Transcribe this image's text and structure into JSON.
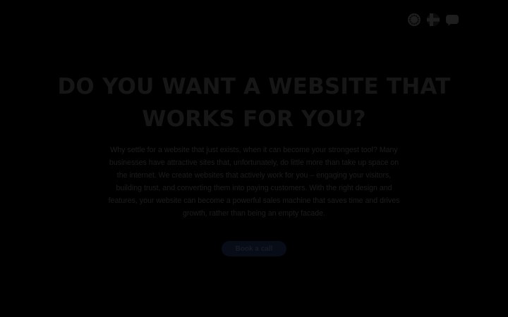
{
  "language_switcher": {
    "options": [
      {
        "icon": "eu-flag-icon"
      },
      {
        "icon": "finland-flag-icon"
      },
      {
        "icon": "chat-icon"
      }
    ]
  },
  "hero": {
    "title": "DO YOU WANT A WEBSITE THAT WORKS FOR YOU?",
    "description": "Why settle for a website that just exists, when it can become your strongest tool? Many businesses have attractive sites that, unfortunately, do little more than take up space on the internet. We create websites that actively work for you – engaging your visitors, building trust, and converting them into paying customers. With the right design and features, your website can become a powerful sales machine that saves time and drives growth, rather than being an empty facade.",
    "cta_label": "Book a call"
  },
  "colors": {
    "background": "#000000",
    "title": "#161616",
    "text": "#1c1c1c",
    "button": "#070c17",
    "icon": "#1e1e1e"
  }
}
